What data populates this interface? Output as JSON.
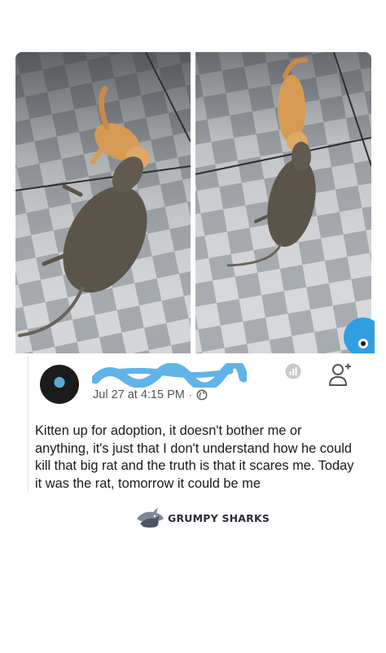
{
  "post": {
    "timestamp": "Jul 27 at 4:15 PM",
    "separator": "·",
    "text": "Kitten up for adoption, it doesn't bother me or anything, it's just that I don't understand how he could kill that big rat and the truth is that it scares me. Today it was the rat, tomorrow it could be me",
    "privacy_icon": "globe-icon",
    "stats_icon": "insights-icon",
    "action_icon": "add-friend-icon"
  },
  "photos": [
    {
      "subject": "kitten-and-rat-left"
    },
    {
      "subject": "kitten-and-rat-right"
    }
  ],
  "brand": {
    "name": "GRUMPY SHARKS",
    "logo_icon": "shark-logo-icon"
  },
  "colors": {
    "tile_light": "#d7d9dc",
    "tile_dark": "#9ea3a8",
    "rat": "#5b544a",
    "kitten": "#d79a55",
    "name_scribble": "#5fb4e8"
  }
}
